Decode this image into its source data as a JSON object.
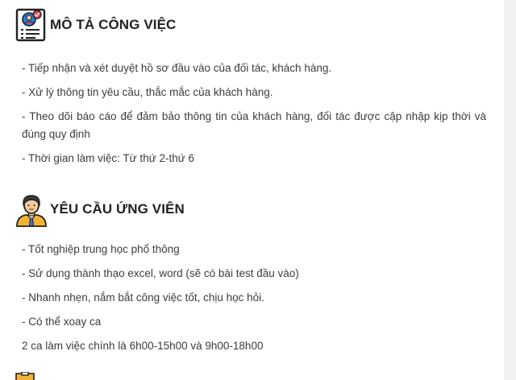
{
  "sections": [
    {
      "title": "MÔ TẢ CÔNG VIỆC",
      "icon": "job-description-icon",
      "items": [
        "- Tiếp nhận và xét duyệt hồ sơ đầu vào của đối tác, khách hàng.",
        "- Xử lý thông tin yêu cầu, thắc mắc của khách hàng.",
        "- Theo dõi báo cáo để đảm bảo thông tin của khách hàng, đối tác được cập nhập kịp thời và đúng quy định",
        "- Thời gian làm việc: Từ thứ 2-thứ 6"
      ]
    },
    {
      "title": "YÊU CẦU ỨNG VIÊN",
      "icon": "candidate-icon",
      "items": [
        "- Tốt nghiệp trung học phổ thông",
        "- Sử dụng thành thạo excel, word (sẽ có bài test đầu vào)",
        "- Nhanh nhẹn, nắm bắt công việc tốt, chịu học hỏi.",
        "- Có thể xoay ca",
        "2 ca làm việc chính là 6h00-15h00 và 9h00-18h00"
      ]
    }
  ],
  "colors": {
    "text": "#3c3c3c",
    "title": "#222222",
    "icon_blue": "#2b7bd6",
    "icon_red": "#e84a4a",
    "icon_skin": "#f5c99b",
    "icon_tie": "#f2b233"
  }
}
